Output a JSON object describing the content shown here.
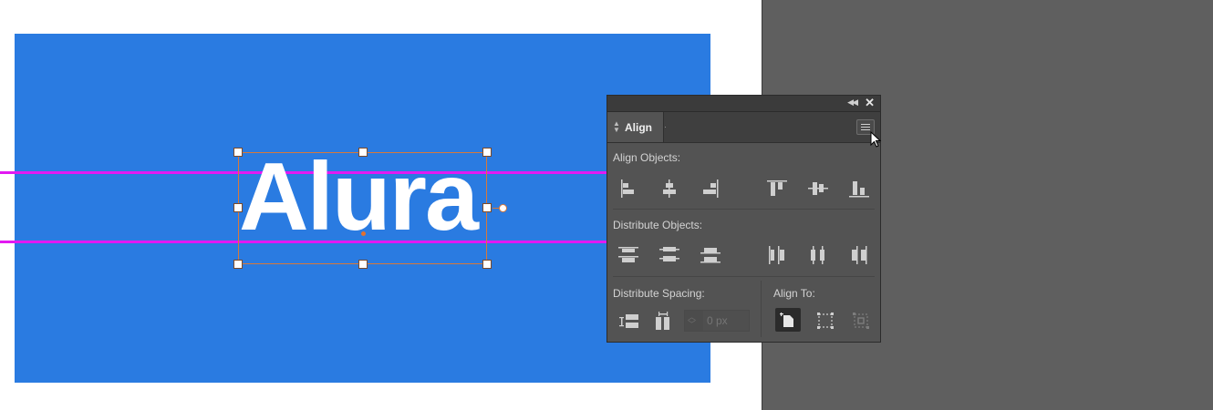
{
  "canvas": {
    "artboard_color": "#2a7be1",
    "guide_color": "#e219f2",
    "selection_color": "#d7793a",
    "text_object": "Alura"
  },
  "align_panel": {
    "tab_label": "Align",
    "sections": {
      "align_objects": "Align Objects:",
      "distribute_objects": "Distribute Objects:",
      "distribute_spacing": "Distribute Spacing:",
      "align_to": "Align To:"
    },
    "spacing_placeholder": "0 px",
    "icons": {
      "collapse": "double-chevron-left-icon",
      "close": "close-icon",
      "menu": "panel-menu-icon"
    }
  }
}
